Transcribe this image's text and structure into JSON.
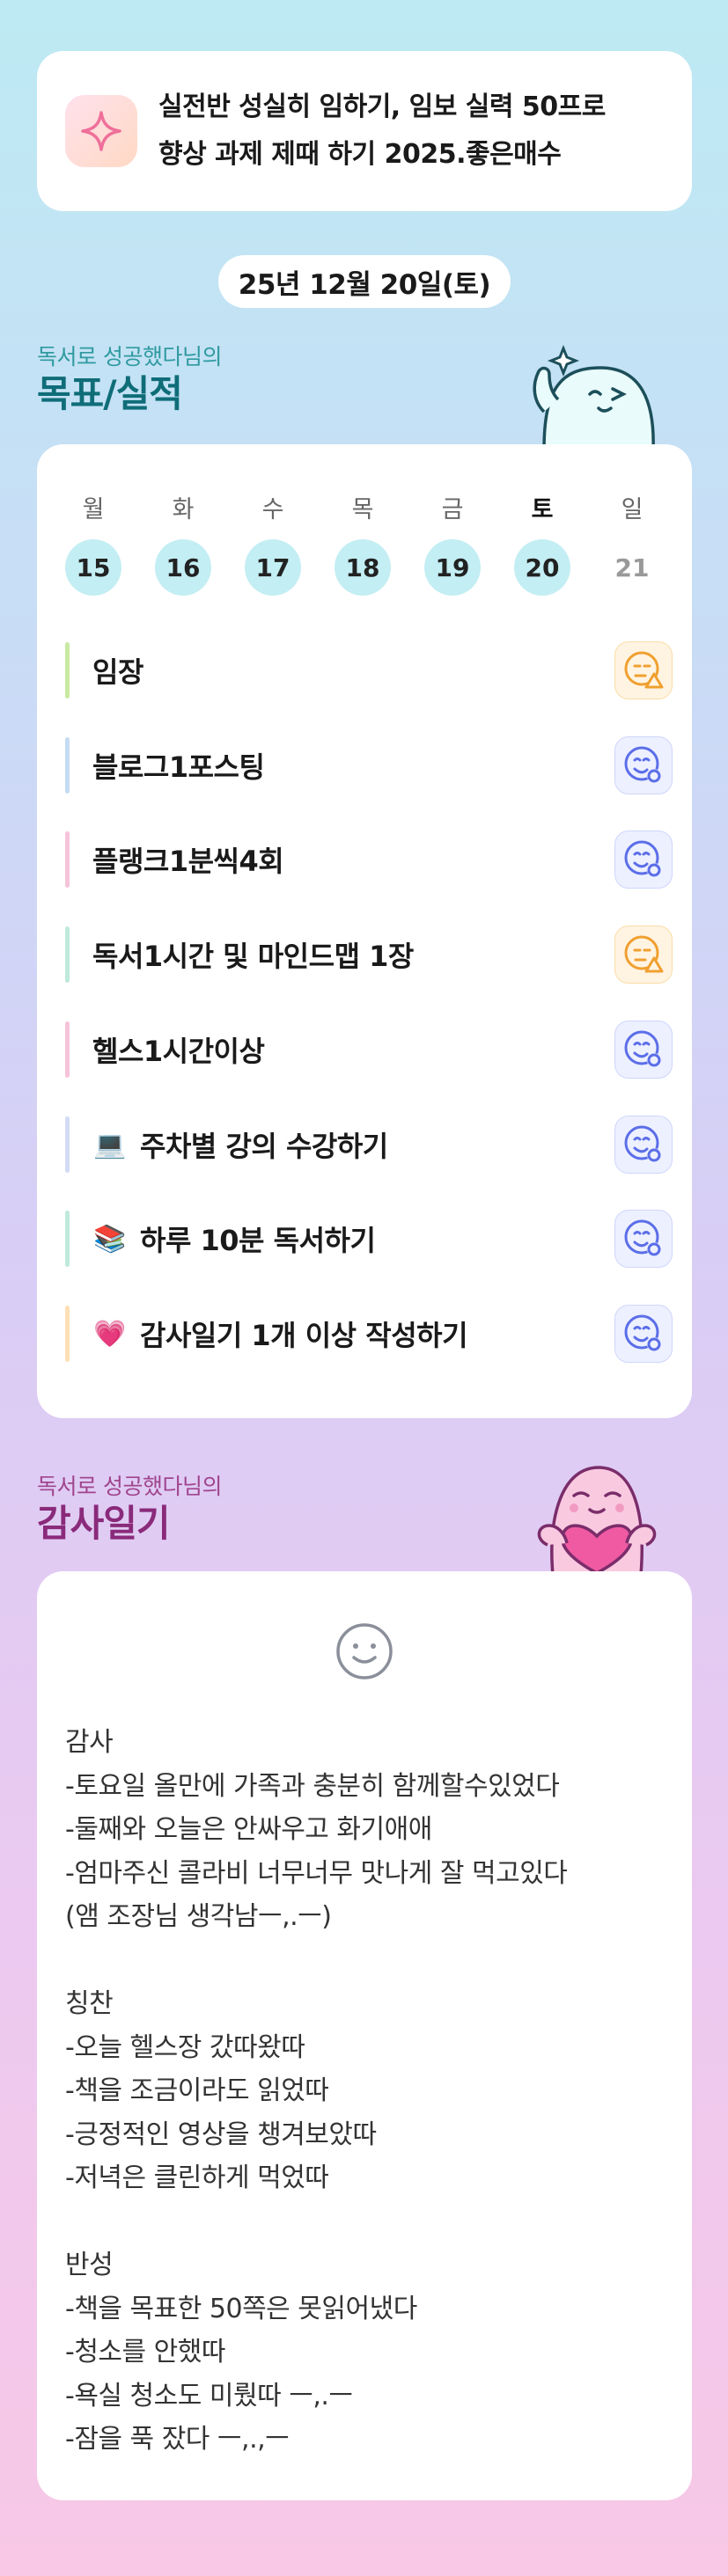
{
  "banner": {
    "line1": "실전반 성실히 임하기, 임보 실력 50프로",
    "line2": "향상 과제 제때 하기 2025.좋은매수",
    "icon": "sparkle-icon"
  },
  "date_label": "25년 12월 20일(토)",
  "goals_section": {
    "subtitle": "독서로 성공했다님의",
    "title": "목표/실적",
    "colors": {
      "subtitle": "#2f9aa0",
      "title": "#0f6d78"
    }
  },
  "week": {
    "days": [
      {
        "weekday": "월",
        "date": "15",
        "state": "done"
      },
      {
        "weekday": "화",
        "date": "16",
        "state": "done"
      },
      {
        "weekday": "수",
        "date": "17",
        "state": "done"
      },
      {
        "weekday": "목",
        "date": "18",
        "state": "done"
      },
      {
        "weekday": "금",
        "date": "19",
        "state": "done"
      },
      {
        "weekday": "토",
        "date": "20",
        "state": "today"
      },
      {
        "weekday": "일",
        "date": "21",
        "state": "future"
      }
    ]
  },
  "goals": [
    {
      "label": "임장",
      "emoji": "",
      "bar_color": "#c8e9a1",
      "status": "warning"
    },
    {
      "label": "블로그1포스팅",
      "emoji": "",
      "bar_color": "#c5dcf4",
      "status": "ok"
    },
    {
      "label": "플랭크1분씩4회",
      "emoji": "",
      "bar_color": "#f6c4da",
      "status": "ok"
    },
    {
      "label": "독서1시간 및 마인드맵 1장",
      "emoji": "",
      "bar_color": "#bfe9dc",
      "status": "warning"
    },
    {
      "label": "헬스1시간이상",
      "emoji": "",
      "bar_color": "#f6c4da",
      "status": "ok"
    },
    {
      "label": "주차별 강의 수강하기",
      "emoji": "💻",
      "bar_color": "#d3dcf6",
      "status": "ok"
    },
    {
      "label": "하루 10분 독서하기",
      "emoji": "📚",
      "bar_color": "#bfe9dc",
      "status": "ok"
    },
    {
      "label": "감사일기 1개 이상 작성하기",
      "emoji": "💗",
      "bar_color": "#fde0b5",
      "status": "ok"
    }
  ],
  "diary_section": {
    "subtitle": "독서로 성공했다님의",
    "title": "감사일기",
    "colors": {
      "subtitle": "#a0458e",
      "title": "#8a2a7a"
    }
  },
  "diary": {
    "mood_icon": "smile-icon",
    "text": "감사\n-토요일 올만에 가족과 충분히 함께할수있었다\n-둘째와 오늘은 안싸우고 화기애애\n-엄마주신 콜라비 너무너무 맛나게 잘 먹고있다\n(앰 조장님 생각남ㅡ,.ㅡ)\n\n칭찬\n-오늘 헬스장 갔따왔따\n-책을 조금이라도 읽었따\n-긍정적인 영상을 챙겨보았따\n-저녁은 클린하게 먹었따\n\n반성\n-책을 목표한 50쪽은 못읽어냈다\n-청소를 안했따\n-욕실 청소도 미뤘따 ㅡ,.ㅡ\n-잠을 푹 잤다 ㅡ,.,ㅡ"
  },
  "mascots": {
    "goals": "mint-ghost-mascot",
    "diary": "pink-heart-mascot"
  },
  "colors": {
    "status_ok": "#5b6ee8",
    "status_warning": "#f0a030",
    "day_circle": "#c3eef3"
  }
}
